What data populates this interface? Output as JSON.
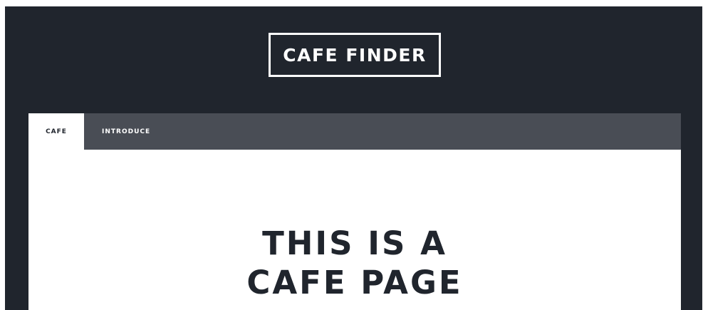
{
  "header": {
    "logo_text": "CAFE FINDER"
  },
  "tabs": [
    {
      "label": "CAFE",
      "active": true
    },
    {
      "label": "INTRODUCE",
      "active": false
    }
  ],
  "hero": {
    "line1": "THIS IS A",
    "line2": "CAFE PAGE"
  },
  "colors": {
    "background": "#20252d",
    "tabbar": "#494d55",
    "card": "#ffffff",
    "text_dark": "#20252d",
    "text_light": "#ffffff"
  }
}
